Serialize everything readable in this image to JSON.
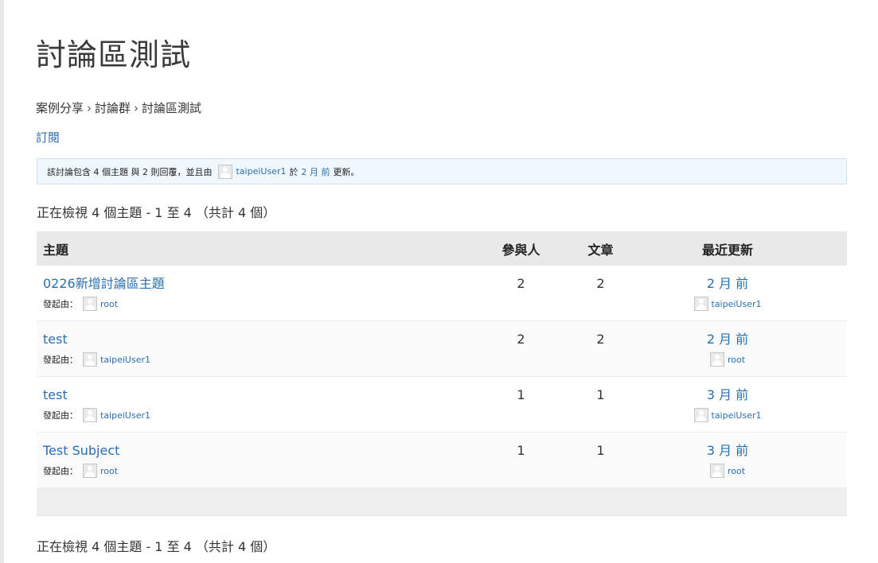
{
  "page": {
    "title": "討論區測試",
    "breadcrumb": [
      "案例分享",
      "討論群",
      "討論區測試"
    ],
    "breadcrumb_sep": "›",
    "subscribe_label": "訂閱"
  },
  "notice": {
    "prefix": "該討論包含 4 個主題 與 2 則回覆，並且由",
    "user": "taipeiUser1",
    "middle": "於",
    "time": "2 月 前",
    "suffix": "更新。"
  },
  "pagination_text": "正在檢視 4 個主題 - 1 至 4 （共計 4 個）",
  "table": {
    "headers": {
      "topic": "主題",
      "voices": "參與人",
      "posts": "文章",
      "freshness": "最近更新"
    },
    "started_by_label": "發起由：",
    "rows": [
      {
        "title": "0226新增討論區主題",
        "author": "root",
        "voices": "2",
        "posts": "2",
        "fresh_time": "2 月 前",
        "fresh_author": "taipeiUser1"
      },
      {
        "title": "test",
        "author": "taipeiUser1",
        "voices": "2",
        "posts": "2",
        "fresh_time": "2 月 前",
        "fresh_author": "root"
      },
      {
        "title": "test",
        "author": "taipeiUser1",
        "voices": "1",
        "posts": "1",
        "fresh_time": "3 月 前",
        "fresh_author": "taipeiUser1"
      },
      {
        "title": "Test Subject",
        "author": "root",
        "voices": "1",
        "posts": "1",
        "fresh_time": "3 月 前",
        "fresh_author": "root"
      }
    ]
  },
  "colors": {
    "link": "#2a6fb0",
    "notice_bg": "#f1f8fd",
    "header_bg": "#e9e9e9"
  },
  "icons": {
    "avatar": "avatar-icon"
  }
}
